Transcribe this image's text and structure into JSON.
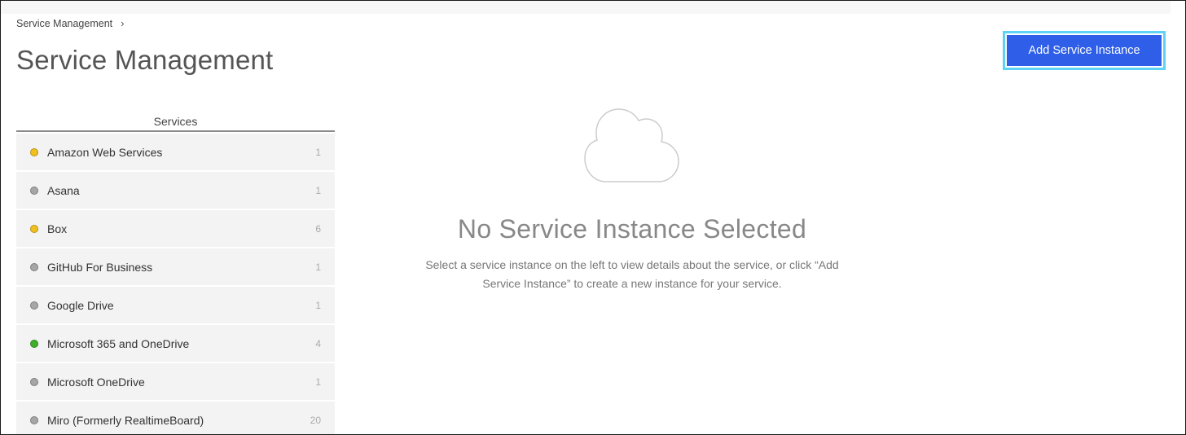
{
  "breadcrumb": {
    "item": "Service Management",
    "separator": "›"
  },
  "page": {
    "title": "Service Management"
  },
  "actions": {
    "add_service_instance": "Add Service Instance"
  },
  "services": {
    "header": "Services",
    "items": [
      {
        "name": "Amazon Web Services",
        "count": "1",
        "status_color": "#f2c01e"
      },
      {
        "name": "Asana",
        "count": "1",
        "status_color": "#a6a6a6"
      },
      {
        "name": "Box",
        "count": "6",
        "status_color": "#f2c01e"
      },
      {
        "name": "GitHub For Business",
        "count": "1",
        "status_color": "#a6a6a6"
      },
      {
        "name": "Google Drive",
        "count": "1",
        "status_color": "#a6a6a6"
      },
      {
        "name": "Microsoft 365 and OneDrive",
        "count": "4",
        "status_color": "#3fae2a"
      },
      {
        "name": "Microsoft OneDrive",
        "count": "1",
        "status_color": "#a6a6a6"
      },
      {
        "name": "Miro (Formerly RealtimeBoard)",
        "count": "20",
        "status_color": "#a6a6a6"
      }
    ]
  },
  "empty_state": {
    "icon": "cloud-icon",
    "title": "No Service Instance Selected",
    "description": "Select a service instance on the left to view details about the service, or click “Add Service Instance” to create a new instance for your service."
  },
  "colors": {
    "primary_button": "#2f5fe8",
    "focus_ring": "#5fd3f5",
    "list_bg": "#f3f3f3"
  }
}
